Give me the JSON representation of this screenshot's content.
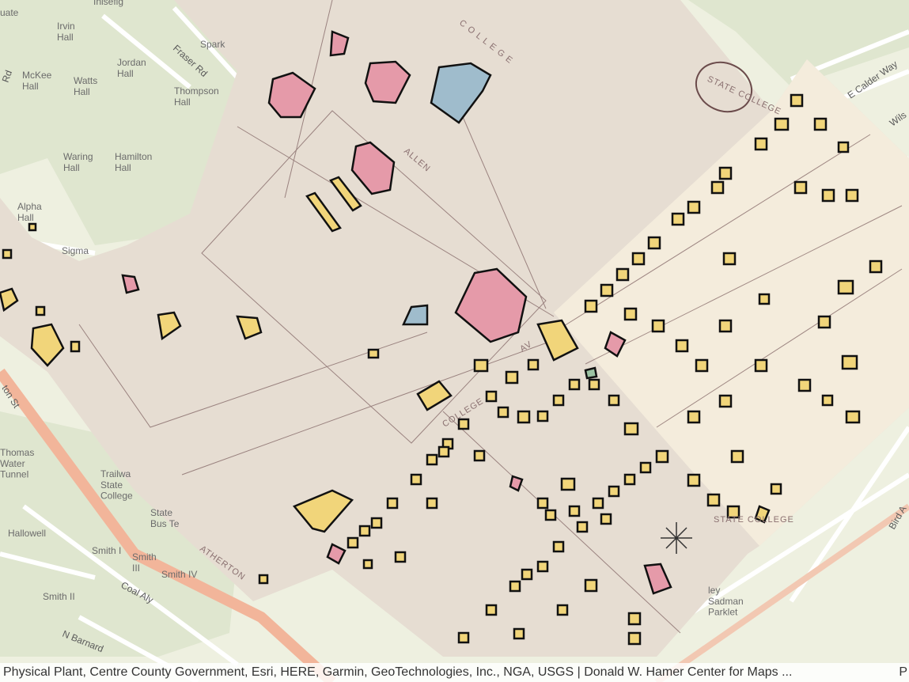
{
  "map": {
    "basemap_labels": {
      "irvin_hall": "Irvin\nHall",
      "jordan_hall": "Jordan\nHall",
      "mckee_hall": "McKee\nHall",
      "watts_hall": "Watts\nHall",
      "thompson_hall": "Thompson\nHall",
      "waring_hall": "Waring\nHall",
      "hamilton_hall": "Hamilton\nHall",
      "alpha_hall": "Alpha\nHall",
      "sigma": "Sigma",
      "thomas_water_tunnel": "Thomas\nWater\nTunnel",
      "trailways": "Trailwa\nState\nCollege",
      "state_bus": "State\nBus Te",
      "hallowell": "Hallowell",
      "smith_i": "Smith I",
      "smith_iii": "Smith\nIII",
      "smith_iv": "Smith IV",
      "smith_ii": "Smith II",
      "sadman_parklet": "ley\nSadman\nParklet",
      "spark": "Spark",
      "inisefig": "Inisefig",
      "uate": "uate"
    },
    "road_labels": {
      "fraser_rd": "Fraser Rd",
      "e_calder_way": "E Calder Way",
      "wils": "Wils",
      "coal_aly": "Coal Aly",
      "n_barnard": "N Barnard",
      "ton_st": "ton St",
      "bird_a": "Bird A",
      "rd": "Rd"
    },
    "sanborn_labels": {
      "state_college_stamp": "STATE COLLEGE",
      "college": "C O L L E G E",
      "allen": "ALLEN",
      "college_av": "COLLEGE",
      "av": "AV",
      "atherton": "ATHERTON",
      "state_small": "STATE COLLEGE"
    },
    "colors": {
      "basemap": "#eef0e0",
      "sanborn_paper": "#e6ddd2",
      "sanborn_paper_light": "#f4ecdc",
      "brick": "#e59aa9",
      "frame": "#f1d57a",
      "stone": "#9fbccc"
    }
  },
  "attribution": {
    "text": "Physical Plant, Centre County Government, Esri, HERE, Garmin, GeoTechnologies, Inc., NGA, USGS | Donald W. Hamer Center for Maps ...",
    "trailing": "P"
  }
}
